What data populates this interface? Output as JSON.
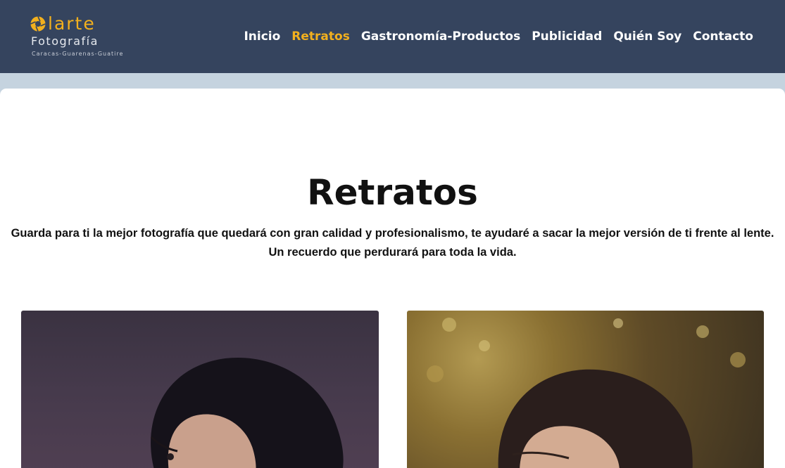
{
  "header": {
    "logo": {
      "word": "larte",
      "subtitle": "Fotografía",
      "location": "Caracas-Guarenas-Guatire"
    },
    "nav": [
      {
        "label": "Inicio",
        "active": false
      },
      {
        "label": "Retratos",
        "active": true
      },
      {
        "label": "Gastronomía-Productos",
        "active": false
      },
      {
        "label": "Publicidad",
        "active": false
      },
      {
        "label": "Quién Soy",
        "active": false
      },
      {
        "label": "Contacto",
        "active": false
      }
    ]
  },
  "main": {
    "title": "Retratos",
    "intro": "Guarda para ti la mejor fotografía que quedará con gran calidad y profesionalismo, te ayudaré a sacar la mejor versión de ti frente al lente. Un recuerdo que perdurará para toda la vida."
  },
  "colors": {
    "header_bg": "#35445e",
    "accent": "#f2b01e",
    "page_bg": "#c5d3df"
  },
  "icons": {
    "logo_mark": "camera-aperture-icon"
  }
}
